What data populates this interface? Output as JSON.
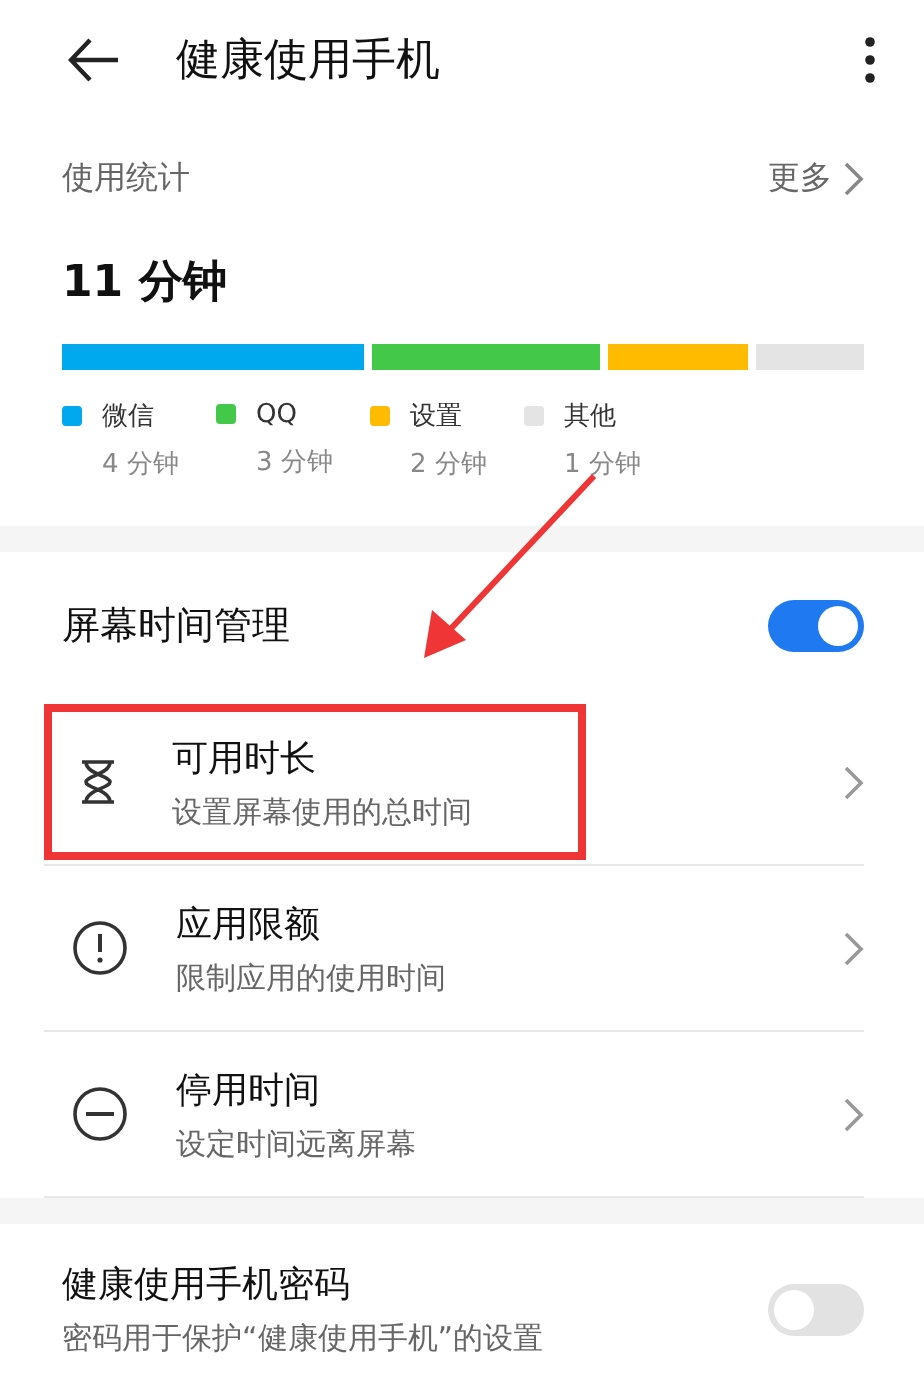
{
  "header": {
    "title": "健康使用手机"
  },
  "usage": {
    "title": "使用统计",
    "more": "更多",
    "total": "11 分钟",
    "apps": [
      {
        "name": "微信",
        "time": "4 分钟",
        "color": "#00a8ee"
      },
      {
        "name": "QQ",
        "time": "3 分钟",
        "color": "#44c84a"
      },
      {
        "name": "设置",
        "time": "2 分钟",
        "color": "#ffbb00"
      },
      {
        "name": "其他",
        "time": "1 分钟",
        "color": "#e4e4e4"
      }
    ]
  },
  "screen_time": {
    "title": "屏幕时间管理",
    "on": true,
    "items": [
      {
        "kind": "hourglass",
        "title": "可用时长",
        "subtitle": "设置屏幕使用的总时间",
        "highlight": true
      },
      {
        "kind": "alert",
        "title": "应用限额",
        "subtitle": "限制应用的使用时间",
        "highlight": false
      },
      {
        "kind": "block",
        "title": "停用时间",
        "subtitle": "设定时间远离屏幕",
        "highlight": false
      }
    ]
  },
  "password": {
    "title": "健康使用手机密码",
    "subtitle": "密码用于保护“健康使用手机”的设置",
    "on": false
  }
}
